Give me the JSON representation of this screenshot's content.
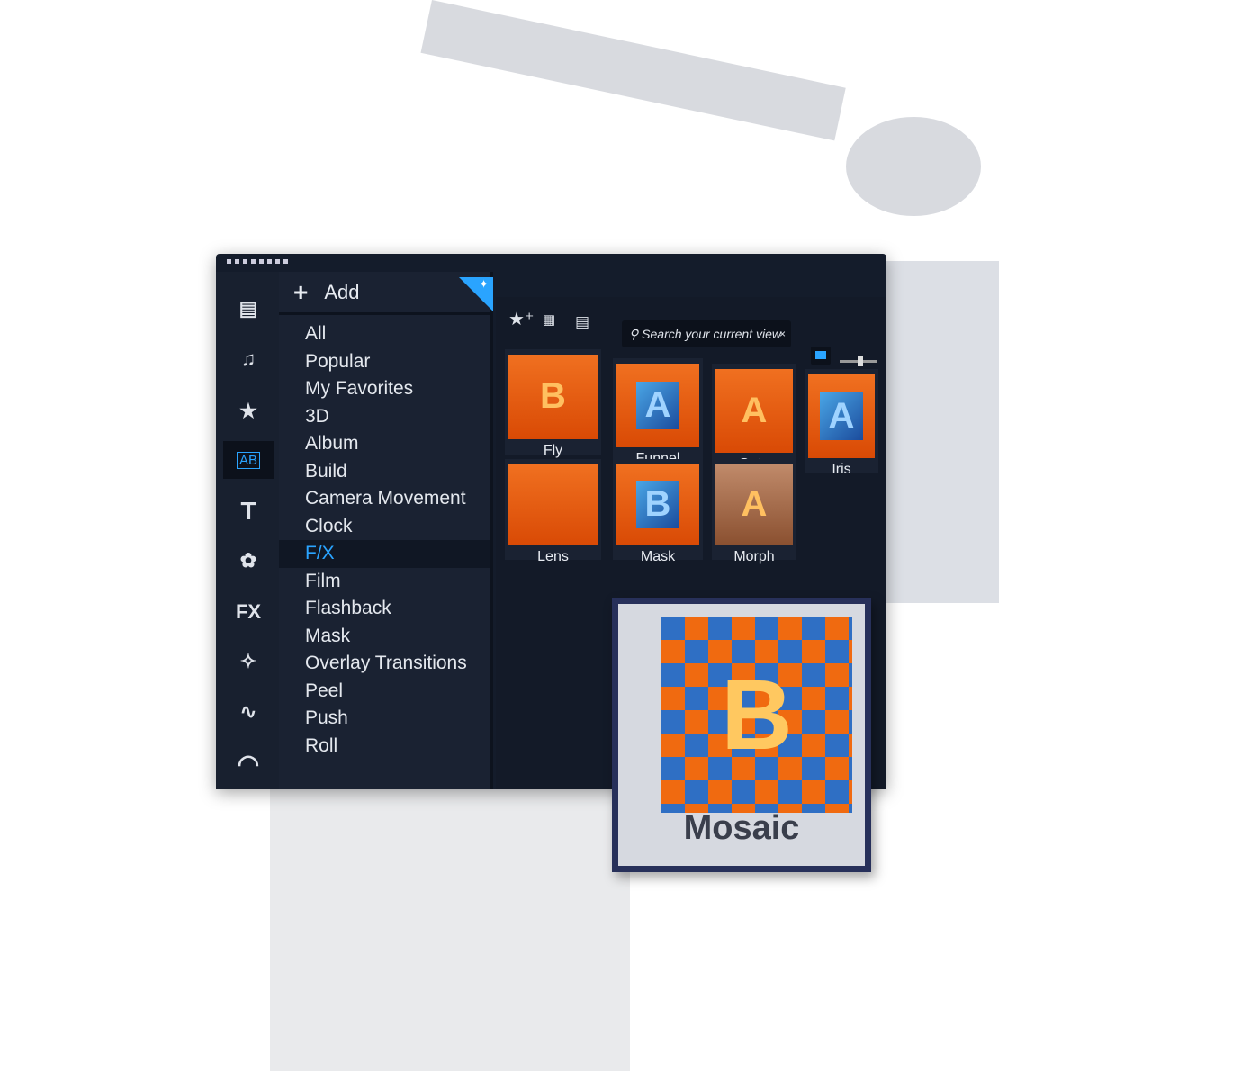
{
  "sidebar": {
    "items": [
      {
        "icon": "media-icon"
      },
      {
        "icon": "audio-icon"
      },
      {
        "icon": "instant-project-icon"
      },
      {
        "icon": "transition-icon",
        "label": "AB",
        "selected": true
      },
      {
        "icon": "title-icon",
        "label": "T"
      },
      {
        "icon": "graphics-icon"
      },
      {
        "icon": "filter-icon",
        "label": "FX"
      },
      {
        "icon": "magic-wand-icon"
      },
      {
        "icon": "path-icon"
      },
      {
        "icon": "speed-icon"
      }
    ]
  },
  "categories": {
    "add_label": "Add",
    "items": [
      "All",
      "Popular",
      "My Favorites",
      "3D",
      "Album",
      "Build",
      "Camera Movement",
      "Clock",
      "F/X",
      "Film",
      "Flashback",
      "Mask",
      "Overlay Transitions",
      "Peel",
      "Push",
      "Roll"
    ],
    "selected": "F/X"
  },
  "toolbar": {
    "search_placeholder": "Search your current view",
    "clear": "×"
  },
  "tiles": [
    "Fly",
    "Funnel",
    "Gate",
    "Iris",
    "Lens",
    "Mask",
    "Morph"
  ],
  "featured": {
    "label": "Mosaic",
    "letter": "B"
  },
  "colors": {
    "accent": "#2aa4ff",
    "panel": "#141c2b",
    "thumb": "#f07020"
  }
}
